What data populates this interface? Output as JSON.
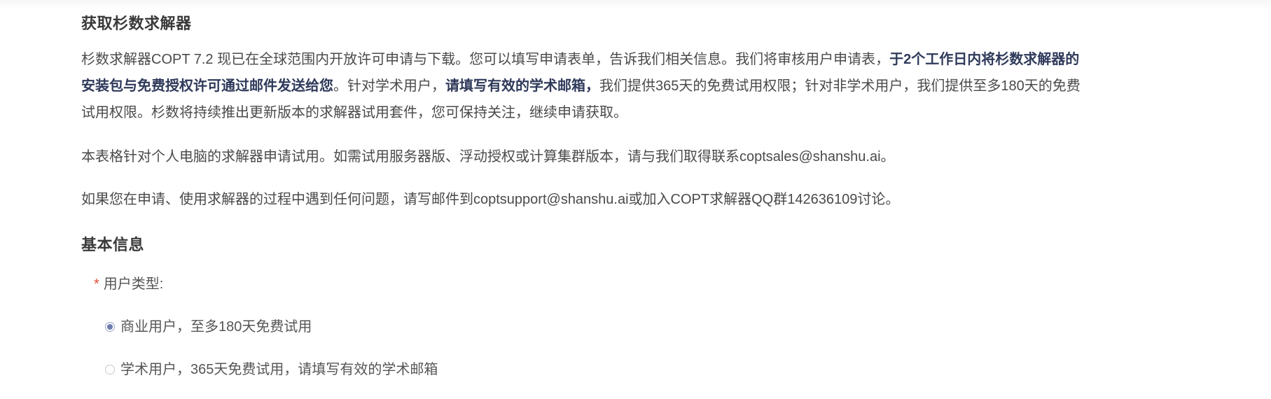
{
  "header": {
    "title": "获取杉数求解器"
  },
  "intro": {
    "part1": "杉数求解器COPT 7.2 现已在全球范围内开放许可申请与下载。您可以填写申请表单，告诉我们相关信息。我们将审核用户申请表，",
    "bold1": "于2个工作日内将杉数求解器的安装包与免费授权许可通过邮件发送给您",
    "part2": "。针对学术用户，",
    "bold2": "请填写有效的学术邮箱，",
    "part3": "我们提供365天的免费试用权限；针对非学术用户，我们提供至多180天的免费试用权限。杉数将持续推出更新版本的求解器试用套件，您可保持关注，继续申请获取。"
  },
  "scope_text": "本表格针对个人电脑的求解器申请试用。如需试用服务器版、浮动授权或计算集群版本，请与我们取得联系coptsales@shanshu.ai。",
  "support_text": "如果您在申请、使用求解器的过程中遇到任何问题，请写邮件到coptsupport@shanshu.ai或加入COPT求解器QQ群142636109讨论。",
  "basic_info": {
    "title": "基本信息",
    "user_type_label": "用户类型:",
    "required_mark": "*",
    "options": [
      {
        "label": "商业用户，至多180天免费试用",
        "selected": true
      },
      {
        "label": "学术用户，365天免费试用，请填写有效的学术邮箱",
        "selected": false
      }
    ]
  },
  "colors": {
    "text": "#4a4a4a",
    "bold_text": "#2f3a5a",
    "required": "#e0503c",
    "radio_accent": "#6f7bb0"
  }
}
